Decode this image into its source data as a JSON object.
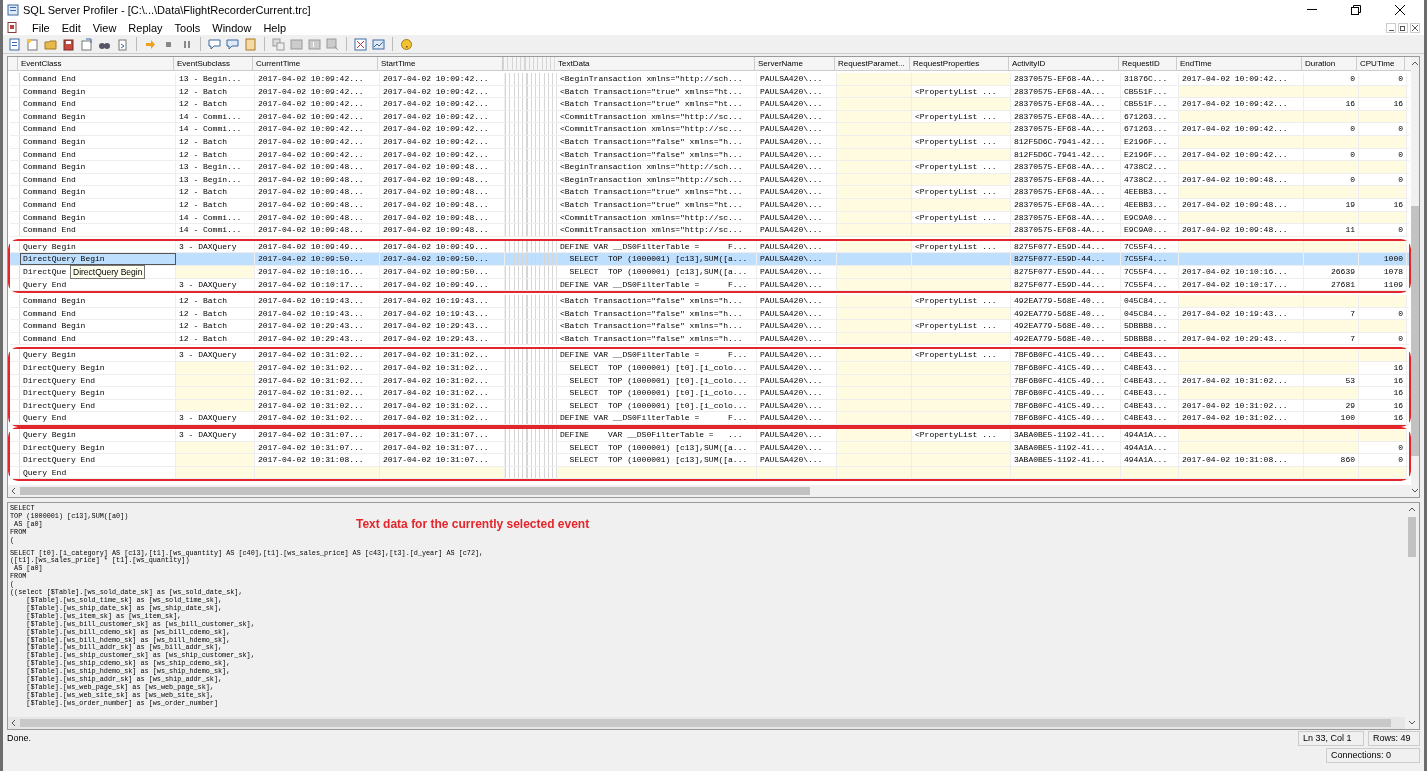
{
  "window": {
    "title": "SQL Server Profiler - [C:\\...\\Data\\FlightRecorderCurrent.trc]"
  },
  "menu": [
    "File",
    "Edit",
    "View",
    "Replay",
    "Tools",
    "Window",
    "Help"
  ],
  "table": {
    "columns": [
      "EventClass",
      "EventSubclass",
      "CurrentTime",
      "StartTime",
      "TextData",
      "ServerName",
      "RequestParamet...",
      "RequestProperties",
      "ActivityID",
      "RequestID",
      "EndTime",
      "Duration",
      "CPUTime"
    ],
    "segments": [
      {
        "outlined": false,
        "rows": [
          {
            "selected": false,
            "cells": [
              "Command End",
              "13 - Begin...",
              "2017-04-02 10:09:42...",
              "2017-04-02 10:09:42...",
              "<BeginTransaction xmlns=\"http://sch...",
              "PAULSA420\\...",
              null,
              null,
              "28370575-EF68-4A...",
              "31876C...",
              "2017-04-02 10:09:42...",
              "0",
              "0"
            ]
          },
          {
            "selected": false,
            "cells": [
              "Command Begin",
              "12 - Batch",
              "2017-04-02 10:09:42...",
              "2017-04-02 10:09:42...",
              "<Batch Transaction=\"true\" xmlns=\"ht...",
              "PAULSA420\\...",
              null,
              "<PropertyList ...",
              "28370575-EF68-4A...",
              "CB551F...",
              null,
              null,
              null
            ]
          },
          {
            "selected": false,
            "cells": [
              "Command End",
              "12 - Batch",
              "2017-04-02 10:09:42...",
              "2017-04-02 10:09:42...",
              "<Batch Transaction=\"true\" xmlns=\"ht...",
              "PAULSA420\\...",
              null,
              null,
              "28370575-EF68-4A...",
              "CB551F...",
              "2017-04-02 10:09:42...",
              "16",
              "16"
            ]
          },
          {
            "selected": false,
            "cells": [
              "Command Begin",
              "14 - Commi...",
              "2017-04-02 10:09:42...",
              "2017-04-02 10:09:42...",
              "<CommitTransaction xmlns=\"http://sc...",
              "PAULSA420\\...",
              null,
              "<PropertyList ...",
              "28370575-EF68-4A...",
              "671263...",
              null,
              null,
              null
            ]
          },
          {
            "selected": false,
            "cells": [
              "Command End",
              "14 - Commi...",
              "2017-04-02 10:09:42...",
              "2017-04-02 10:09:42...",
              "<CommitTransaction xmlns=\"http://sc...",
              "PAULSA420\\...",
              null,
              null,
              "28370575-EF68-4A...",
              "671263...",
              "2017-04-02 10:09:42...",
              "0",
              "0"
            ]
          },
          {
            "selected": false,
            "cells": [
              "Command Begin",
              "12 - Batch",
              "2017-04-02 10:09:42...",
              "2017-04-02 10:09:42...",
              "<Batch Transaction=\"false\" xmlns=\"h...",
              "PAULSA420\\...",
              null,
              "<PropertyList ...",
              "812F5D6C-7941-42...",
              "E2196F...",
              null,
              null,
              null
            ]
          },
          {
            "selected": false,
            "cells": [
              "Command End",
              "12 - Batch",
              "2017-04-02 10:09:42...",
              "2017-04-02 10:09:42...",
              "<Batch Transaction=\"false\" xmlns=\"h...",
              "PAULSA420\\...",
              null,
              null,
              "812F5D6C-7941-42...",
              "E2196F...",
              "2017-04-02 10:09:42...",
              "0",
              "0"
            ]
          },
          {
            "selected": false,
            "cells": [
              "Command Begin",
              "13 - Begin...",
              "2017-04-02 10:09:48...",
              "2017-04-02 10:09:48...",
              "<BeginTransaction xmlns=\"http://sch...",
              "PAULSA420\\...",
              null,
              "<PropertyList ...",
              "28370575-EF68-4A...",
              "4738C2...",
              null,
              null,
              null
            ]
          },
          {
            "selected": false,
            "cells": [
              "Command End",
              "13 - Begin...",
              "2017-04-02 10:09:48...",
              "2017-04-02 10:09:48...",
              "<BeginTransaction xmlns=\"http://sch...",
              "PAULSA420\\...",
              null,
              null,
              "28370575-EF68-4A...",
              "4738C2...",
              "2017-04-02 10:09:48...",
              "0",
              "0"
            ]
          },
          {
            "selected": false,
            "cells": [
              "Command Begin",
              "12 - Batch",
              "2017-04-02 10:09:48...",
              "2017-04-02 10:09:48...",
              "<Batch Transaction=\"true\" xmlns=\"ht...",
              "PAULSA420\\...",
              null,
              "<PropertyList ...",
              "28370575-EF68-4A...",
              "4EEBB3...",
              null,
              null,
              null
            ]
          },
          {
            "selected": false,
            "cells": [
              "Command End",
              "12 - Batch",
              "2017-04-02 10:09:48...",
              "2017-04-02 10:09:48...",
              "<Batch Transaction=\"true\" xmlns=\"ht...",
              "PAULSA420\\...",
              null,
              null,
              "28370575-EF68-4A...",
              "4EEBB3...",
              "2017-04-02 10:09:48...",
              "19",
              "16"
            ]
          },
          {
            "selected": false,
            "cells": [
              "Command Begin",
              "14 - Commi...",
              "2017-04-02 10:09:48...",
              "2017-04-02 10:09:48...",
              "<CommitTransaction xmlns=\"http://sc...",
              "PAULSA420\\...",
              null,
              "<PropertyList ...",
              "28370575-EF68-4A...",
              "E9C9A0...",
              null,
              null,
              null
            ]
          },
          {
            "selected": false,
            "cells": [
              "Command End",
              "14 - Commi...",
              "2017-04-02 10:09:48...",
              "2017-04-02 10:09:48...",
              "<CommitTransaction xmlns=\"http://sc...",
              "PAULSA420\\...",
              null,
              null,
              "28370575-EF68-4A...",
              "E9C9A0...",
              "2017-04-02 10:09:48...",
              "11",
              "0"
            ]
          }
        ]
      },
      {
        "outlined": true,
        "rows": [
          {
            "selected": false,
            "cells": [
              "Query Begin",
              "3 - DAXQuery",
              "2017-04-02 10:09:49...",
              "2017-04-02 10:09:49...",
              "DEFINE VAR __DS0FilterTable =      F...",
              "PAULSA420\\...",
              null,
              "<PropertyList ...",
              "8275F077-E59D-44...",
              "7C55F4...",
              null,
              null,
              null
            ]
          },
          {
            "selected": true,
            "cells": [
              "DirectQuery Begin",
              null,
              "2017-04-02 10:09:50...",
              "2017-04-02 10:09:50...",
              "  SELECT  TOP (1000001) [c13],SUM([a...",
              "PAULSA420\\...",
              null,
              null,
              "8275F077-E59D-44...",
              "7C55F4...",
              null,
              null,
              "1000"
            ]
          },
          {
            "selected": false,
            "tooltip": "DirectQuery Begin",
            "cells": [
              "DirectQue",
              null,
              "2017-04-02 10:10:16...",
              "2017-04-02 10:09:50...",
              "  SELECT  TOP (1000001) [c13],SUM([a...",
              "PAULSA420\\...",
              null,
              null,
              "8275F077-E59D-44...",
              "7C55F4...",
              "2017-04-02 10:10:16...",
              "26639",
              "1078"
            ]
          },
          {
            "selected": false,
            "cells": [
              "Query End",
              "3 - DAXQuery",
              "2017-04-02 10:10:17...",
              "2017-04-02 10:09:49...",
              "DEFINE VAR __DS0FilterTable =      F...",
              "PAULSA420\\...",
              null,
              null,
              "8275F077-E59D-44...",
              "7C55F4...",
              "2017-04-02 10:10:17...",
              "27681",
              "1109"
            ]
          }
        ]
      },
      {
        "outlined": false,
        "rows": [
          {
            "selected": false,
            "cells": [
              "Command Begin",
              "12 - Batch",
              "2017-04-02 10:19:43...",
              "2017-04-02 10:19:43...",
              "<Batch Transaction=\"false\" xmlns=\"h...",
              "PAULSA420\\...",
              null,
              "<PropertyList ...",
              "492EA779-568E-40...",
              "045C84...",
              null,
              null,
              null
            ]
          },
          {
            "selected": false,
            "cells": [
              "Command End",
              "12 - Batch",
              "2017-04-02 10:19:43...",
              "2017-04-02 10:19:43...",
              "<Batch Transaction=\"false\" xmlns=\"h...",
              "PAULSA420\\...",
              null,
              null,
              "492EA779-568E-40...",
              "045C84...",
              "2017-04-02 10:19:43...",
              "7",
              "0"
            ]
          },
          {
            "selected": false,
            "cells": [
              "Command Begin",
              "12 - Batch",
              "2017-04-02 10:29:43...",
              "2017-04-02 10:29:43...",
              "<Batch Transaction=\"false\" xmlns=\"h...",
              "PAULSA420\\...",
              null,
              "<PropertyList ...",
              "492EA779-568E-40...",
              "5DBBB8...",
              null,
              null,
              null
            ]
          },
          {
            "selected": false,
            "cells": [
              "Command End",
              "12 - Batch",
              "2017-04-02 10:29:43...",
              "2017-04-02 10:29:43...",
              "<Batch Transaction=\"false\" xmlns=\"h...",
              "PAULSA420\\...",
              null,
              null,
              "492EA779-568E-40...",
              "5DBBB8...",
              "2017-04-02 10:29:43...",
              "7",
              "0"
            ]
          }
        ]
      },
      {
        "outlined": true,
        "rows": [
          {
            "selected": false,
            "cells": [
              "Query Begin",
              "3 - DAXQuery",
              "2017-04-02 10:31:02...",
              "2017-04-02 10:31:02...",
              "DEFINE VAR __DS0FilterTable =      F...",
              "PAULSA420\\...",
              null,
              "<PropertyList ...",
              "7BF6B0FC-41C5-49...",
              "C4BE43...",
              null,
              null,
              null
            ]
          },
          {
            "selected": false,
            "cells": [
              "DirectQuery Begin",
              null,
              "2017-04-02 10:31:02...",
              "2017-04-02 10:31:02...",
              "  SELECT  TOP (1000001) [t0].[i_colo...",
              "PAULSA420\\...",
              null,
              null,
              "7BF6B0FC-41C5-49...",
              "C4BE43...",
              null,
              null,
              "16"
            ]
          },
          {
            "selected": false,
            "cells": [
              "DirectQuery End",
              null,
              "2017-04-02 10:31:02...",
              "2017-04-02 10:31:02...",
              "  SELECT  TOP (1000001) [t0].[i_colo...",
              "PAULSA420\\...",
              null,
              null,
              "7BF6B0FC-41C5-49...",
              "C4BE43...",
              "2017-04-02 10:31:02...",
              "53",
              "16"
            ]
          },
          {
            "selected": false,
            "cells": [
              "DirectQuery Begin",
              null,
              "2017-04-02 10:31:02...",
              "2017-04-02 10:31:02...",
              "  SELECT  TOP (1000001) [t0].[i_colo...",
              "PAULSA420\\...",
              null,
              null,
              "7BF6B0FC-41C5-49...",
              "C4BE43...",
              null,
              null,
              "16"
            ]
          },
          {
            "selected": false,
            "cells": [
              "DirectQuery End",
              null,
              "2017-04-02 10:31:02...",
              "2017-04-02 10:31:02...",
              "  SELECT  TOP (1000001) [t0].[i_colo...",
              "PAULSA420\\...",
              null,
              null,
              "7BF6B0FC-41C5-49...",
              "C4BE43...",
              "2017-04-02 10:31:02...",
              "29",
              "16"
            ]
          },
          {
            "selected": false,
            "cells": [
              "Query End",
              "3 - DAXQuery",
              "2017-04-02 10:31:02...",
              "2017-04-02 10:31:02...",
              "DEFINE VAR __DS0FilterTable =      F...",
              "PAULSA420\\...",
              null,
              null,
              "7BF6B0FC-41C5-49...",
              "C4BE43...",
              "2017-04-02 10:31:02...",
              "100",
              "16"
            ]
          }
        ]
      },
      {
        "outlined": true,
        "rows": [
          {
            "selected": false,
            "cells": [
              "Query Begin",
              "3 - DAXQuery",
              "2017-04-02 10:31:07...",
              "2017-04-02 10:31:07...",
              "DEFINE    VAR __DS0FilterTable =   ...",
              "PAULSA420\\...",
              null,
              "<PropertyList ...",
              "3ABA0BE5-1192-41...",
              "494A1A...",
              null,
              null,
              null
            ]
          },
          {
            "selected": false,
            "cells": [
              "DirectQuery Begin",
              null,
              "2017-04-02 10:31:07...",
              "2017-04-02 10:31:07...",
              "  SELECT  TOP (1000001) [c13],SUM([a...",
              "PAULSA420\\...",
              null,
              null,
              "3ABA0BE5-1192-41...",
              "494A1A...",
              null,
              null,
              "0"
            ]
          },
          {
            "selected": false,
            "cells": [
              "DirectQuery End",
              null,
              "2017-04-02 10:31:08...",
              "2017-04-02 10:31:07...",
              "  SELECT  TOP (1000001) [c13],SUM([a...",
              "PAULSA420\\...",
              null,
              null,
              "3ABA0BE5-1192-41...",
              "494A1A...",
              "2017-04-02 10:31:08...",
              "860",
              "0"
            ]
          },
          {
            "selected": false,
            "cells": [
              "Query End",
              null,
              null,
              null,
              null,
              null,
              null,
              null,
              null,
              null,
              null,
              null,
              null
            ]
          }
        ]
      }
    ]
  },
  "text_pane": {
    "note": "Text data for the currently selected event",
    "blocks": [
      [
        "SELECT",
        "TOP (1000001) [c13],SUM([a0])",
        " AS [a0]",
        "FROM",
        "("
      ],
      [
        "SELECT [t0].[i_category] AS [c13],[t1].[ws_quantity] AS [c40],[t1].[ws_sales_price] AS [c43],[t3].[d_year] AS [c72],",
        "([t1].[ws_sales_price] * [t1].[ws_quantity])",
        " AS [a0]",
        "FROM",
        "(",
        "((select [$Table].[ws_sold_date_sk] as [ws_sold_date_sk],",
        "    [$Table].[ws_sold_time_sk] as [ws_sold_time_sk],",
        "    [$Table].[ws_ship_date_sk] as [ws_ship_date_sk],",
        "    [$Table].[ws_item_sk] as [ws_item_sk],",
        "    [$Table].[ws_bill_customer_sk] as [ws_bill_customer_sk],",
        "    [$Table].[ws_bill_cdemo_sk] as [ws_bill_cdemo_sk],",
        "    [$Table].[ws_bill_hdemo_sk] as [ws_bill_hdemo_sk],",
        "    [$Table].[ws_bill_addr_sk] as [ws_bill_addr_sk],",
        "    [$Table].[ws_ship_customer_sk] as [ws_ship_customer_sk],",
        "    [$Table].[ws_ship_cdemo_sk] as [ws_ship_cdemo_sk],",
        "    [$Table].[ws_ship_hdemo_sk] as [ws_ship_hdemo_sk],",
        "    [$Table].[ws_ship_addr_sk] as [ws_ship_addr_sk],",
        "    [$Table].[ws_web_page_sk] as [ws_web_page_sk],",
        "    [$Table].[ws_web_site_sk] as [ws_web_site_sk],",
        "    [$Table].[ws_order_number] as [ws_order_number]"
      ]
    ]
  },
  "status_bar": {
    "message": "Done.",
    "position": "Ln 33, Col 1",
    "rows": "Rows: 49",
    "connections": "Connections: 0"
  }
}
